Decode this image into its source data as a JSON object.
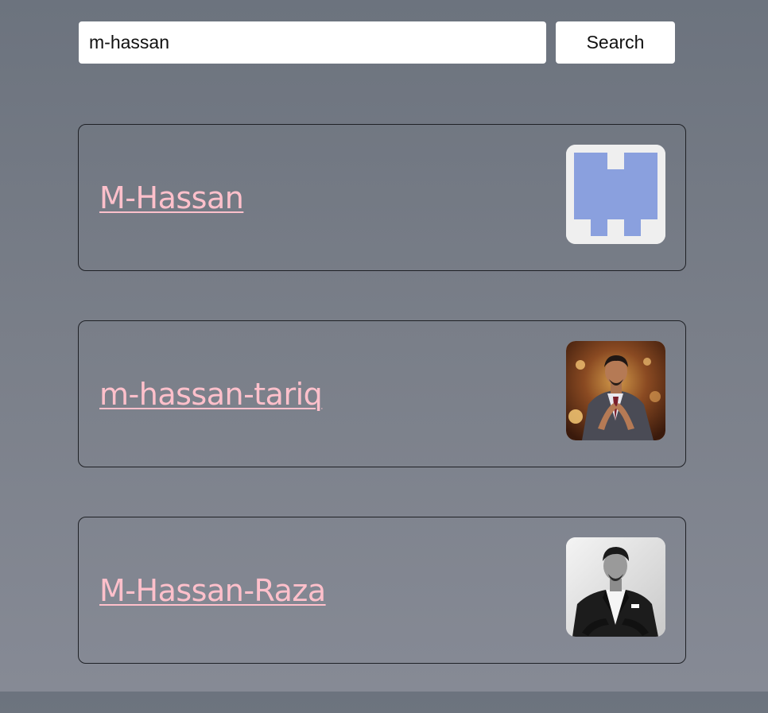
{
  "search": {
    "value": "m-hassan",
    "button_label": "Search"
  },
  "results": [
    {
      "username": "M-Hassan",
      "avatar": "identicon-avatar",
      "avatar_color": "#8aa0de"
    },
    {
      "username": "m-hassan-tariq",
      "avatar": "photo-avatar-man-in-suit-color"
    },
    {
      "username": "M-Hassan-Raza",
      "avatar": "photo-avatar-man-in-suit-grayscale"
    }
  ],
  "colors": {
    "link": "#ffc0cb",
    "card_border": "#1f2126",
    "background_top": "#6c737e",
    "background_bottom": "#868a95"
  }
}
